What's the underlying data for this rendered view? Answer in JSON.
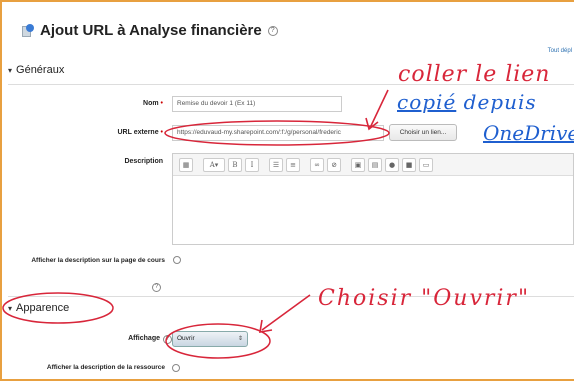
{
  "page": {
    "title": "Ajout URL à Analyse financière",
    "expand_all": "Tout dépl"
  },
  "sections": {
    "generaux": "Généraux",
    "apparence": "Apparence"
  },
  "form": {
    "nom_label": "Nom",
    "nom_value": "Remise du devoir 1 (Ex 11)",
    "url_label": "URL externe",
    "url_value": "https://eduvaud-my.sharepoint.com/:f:/g/personal/frederic",
    "choose_link_label": "Choisir un lien...",
    "description_label": "Description",
    "show_desc_label": "Afficher la description sur la page de cours",
    "affichage_label": "Affichage",
    "affichage_value": "Ouvrir",
    "show_desc_resource_label": "Afficher la description de la ressource"
  },
  "annotations": {
    "line1": "coller le lien",
    "line2_a": "copié",
    "line2_b": "depuis",
    "line3": "OneDrive",
    "choose": "Choisir \"Ouvrir\""
  },
  "colors": {
    "annotation_red": "#d8263a",
    "annotation_blue": "#1f5fcf",
    "frame_orange": "#e8a040"
  }
}
